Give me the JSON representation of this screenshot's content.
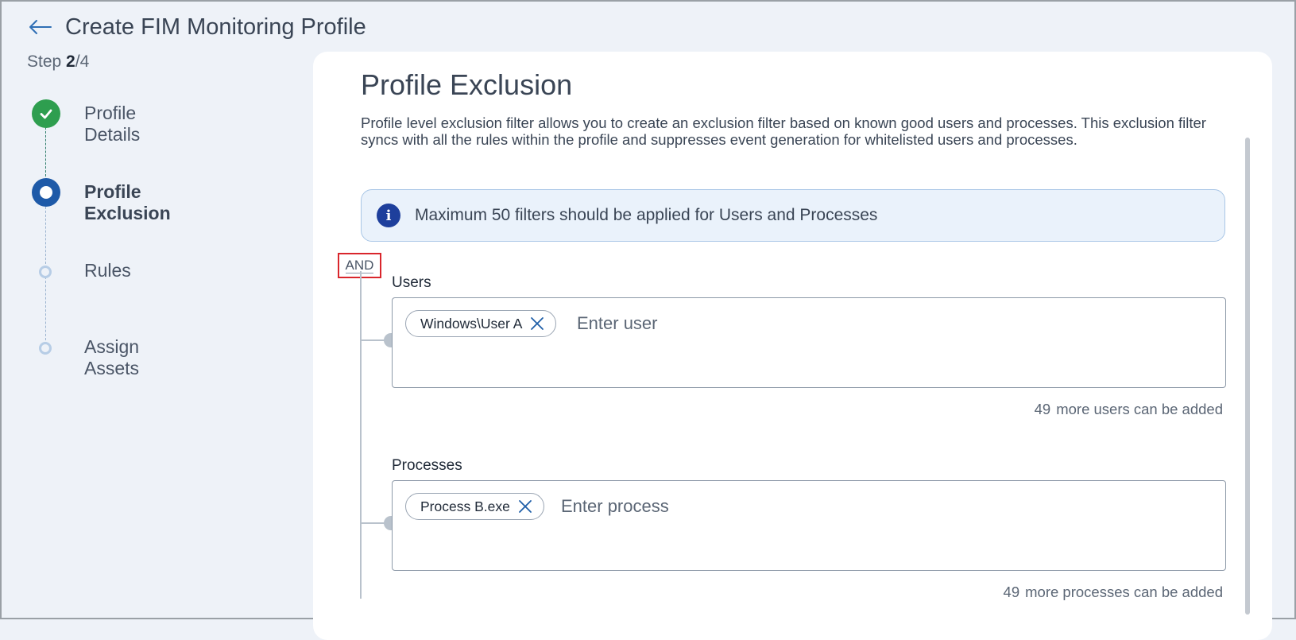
{
  "header": {
    "title": "Create FIM Monitoring Profile",
    "back_icon": "back-arrow-icon"
  },
  "step": {
    "prefix": "Step ",
    "current": "2",
    "total": "/4"
  },
  "stepper": {
    "steps": [
      {
        "label": "Profile Details",
        "state": "done"
      },
      {
        "label": "Profile Exclusion",
        "state": "current"
      },
      {
        "label": "Rules",
        "state": "pending"
      },
      {
        "label": "Assign Assets",
        "state": "pending"
      }
    ]
  },
  "main": {
    "title": "Profile Exclusion",
    "description": "Profile level exclusion filter allows you to create an exclusion filter based on known good users and processes. This exclusion filter syncs with all the rules within the profile and suppresses event generation for whitelisted users and processes.",
    "info_banner": "Maximum 50 filters should be applied for Users and Processes",
    "operator": "AND",
    "users": {
      "label": "Users",
      "chips": [
        "Windows\\User A"
      ],
      "placeholder": "Enter user",
      "remaining_count": "49",
      "remaining_text": "more users can be added"
    },
    "processes": {
      "label": "Processes",
      "chips": [
        "Process B.exe"
      ],
      "placeholder": "Enter process",
      "remaining_count": "49",
      "remaining_text": "more processes can be added"
    }
  },
  "colors": {
    "accent": "#1e5aa8",
    "success": "#2e9e4f",
    "info_icon": "#1e3f9c",
    "highlight_border": "#d9262c",
    "background": "#eef2f8"
  }
}
